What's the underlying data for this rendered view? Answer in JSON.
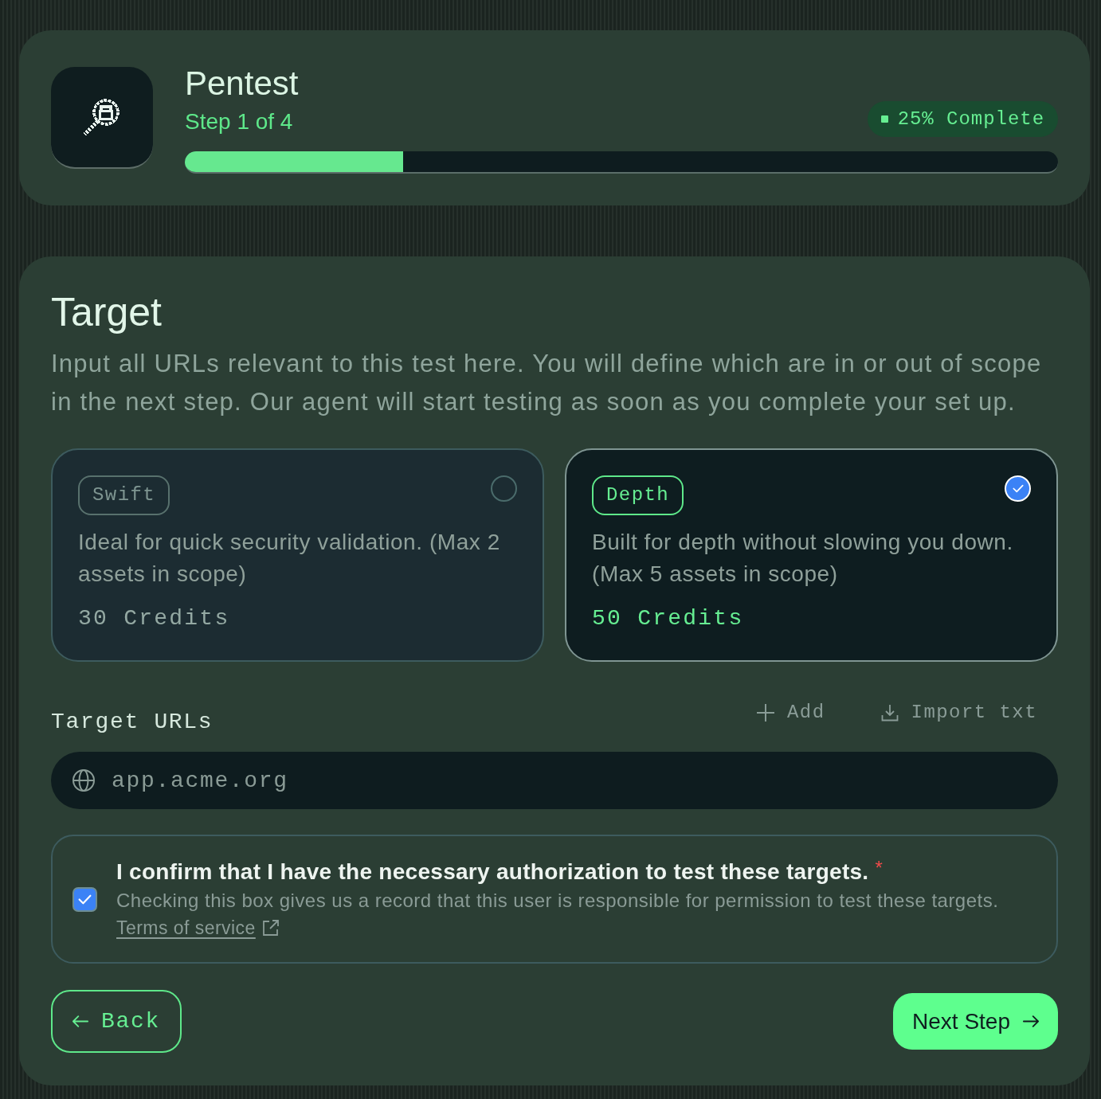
{
  "header": {
    "title": "Pentest",
    "step": "Step 1 of 4",
    "badge": "25% Complete",
    "progress": {
      "level": 0.25
    }
  },
  "section": {
    "title": "Target",
    "description": "Input all URLs relevant to this test here. You will define which are in or out of scope in the next step. Our agent will start testing as soon as you complete your set up."
  },
  "plans": [
    {
      "tag": "Swift",
      "description": "Ideal for quick security validation. (Max 2 assets in scope)",
      "credits": "30 Credits",
      "selected": false
    },
    {
      "tag": "Depth",
      "description": "Built for depth without slowing you down. (Max 5 assets in scope)",
      "credits": "50 Credits",
      "selected": true
    }
  ],
  "target_urls": {
    "label": "Target URLs",
    "actions": [
      {
        "kind": "add",
        "label": "Add"
      },
      {
        "kind": "import",
        "label": "Import txt"
      }
    ],
    "input": {
      "placeholder": "app.acme.org"
    }
  },
  "consent": {
    "checked": true,
    "title": "I confirm that I have the necessary authorization to test these targets.",
    "required_mark": "*",
    "hint": "Checking this box gives us a record that this user is responsible for permission to test these targets.",
    "link": "Terms of service"
  },
  "buttons": [
    {
      "kind": "back",
      "label": "Back"
    },
    {
      "kind": "next",
      "label": "Next Step"
    }
  ]
}
